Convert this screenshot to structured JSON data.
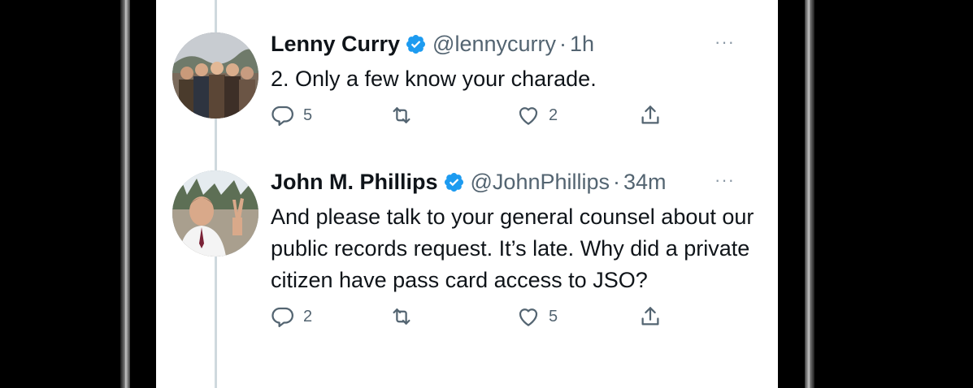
{
  "colors": {
    "verified": "#1d9bf0",
    "text_primary": "#0f1419",
    "text_secondary": "#536471",
    "thread_line": "#cfd9de"
  },
  "tweets": [
    {
      "display_name": "Lenny Curry",
      "handle": "@lennycurry",
      "separator": "·",
      "time": "1h",
      "more": "···",
      "text": "2. Only a few know your charade.",
      "avatar_icon": "group-photo-avatar",
      "actions": {
        "reply_count": "5",
        "retweet_count": "",
        "like_count": "2"
      }
    },
    {
      "display_name": "John M. Phillips",
      "handle": "@JohnPhillips",
      "separator": "·",
      "time": "34m",
      "more": "···",
      "text": "And please talk to your general counsel about our public records request. It’s late. Why did a private citizen have pass card access to JSO?",
      "avatar_icon": "man-peace-sign-avatar",
      "actions": {
        "reply_count": "2",
        "retweet_count": "",
        "like_count": "5"
      }
    }
  ]
}
